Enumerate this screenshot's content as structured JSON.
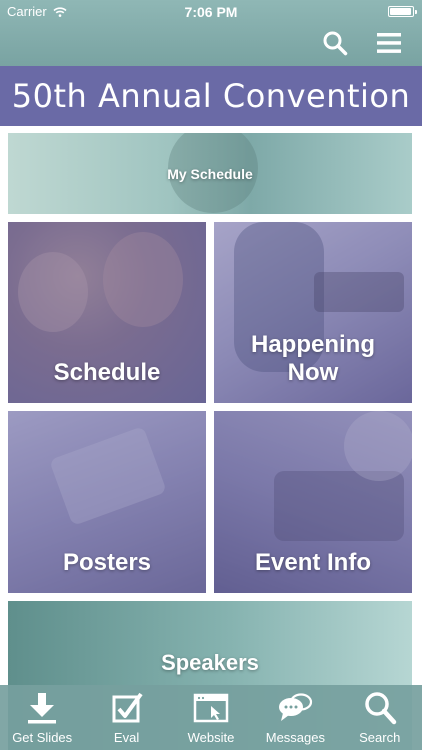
{
  "status_bar": {
    "carrier": "Carrier",
    "time": "7:06 PM",
    "battery_level": 0.95
  },
  "nav": {
    "search_icon": "search-icon",
    "menu_icon": "hamburger-menu-icon"
  },
  "banner": {
    "title": "50th Annual Convention"
  },
  "tiles": {
    "my_schedule": "My Schedule",
    "schedule": "Schedule",
    "happening_now_line1": "Happening",
    "happening_now_line2": "Now",
    "posters": "Posters",
    "event_info": "Event Info",
    "speakers": "Speakers"
  },
  "tabbar": [
    {
      "label": "Get Slides",
      "icon": "download-icon"
    },
    {
      "label": "Eval",
      "icon": "checkbox-icon"
    },
    {
      "label": "Website",
      "icon": "browser-window-icon"
    },
    {
      "label": "Messages",
      "icon": "chat-bubbles-icon"
    },
    {
      "label": "Search",
      "icon": "search-icon"
    }
  ],
  "colors": {
    "nav_teal": "#79a3a2",
    "banner_purple": "#6a6aa6",
    "tile_overlay": "#67609e"
  }
}
